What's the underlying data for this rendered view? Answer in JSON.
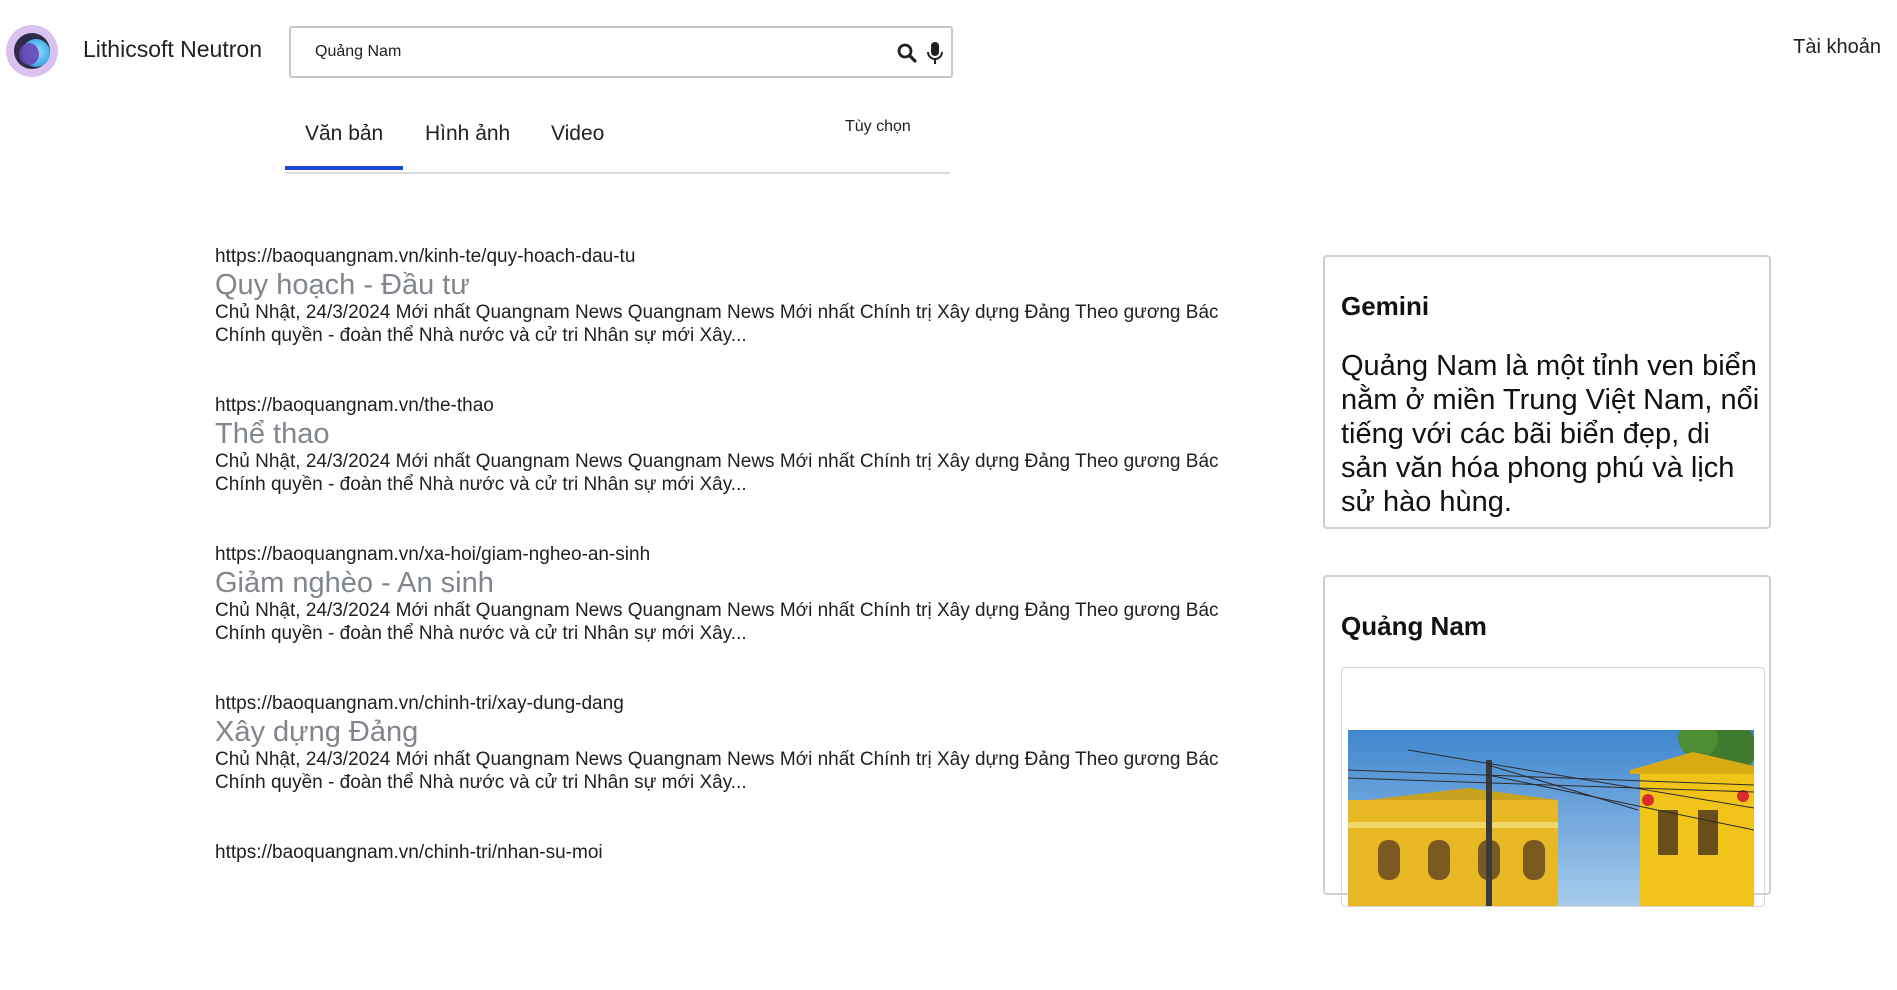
{
  "app": {
    "brand_name": "Lithicsoft Neutron",
    "logo_icon": "neutron-logo-icon",
    "account_label": "Tài khoản"
  },
  "search": {
    "query": "Quảng Nam",
    "search_icon": "search-icon",
    "mic_icon": "microphone-icon"
  },
  "tabs": {
    "items": [
      {
        "label": "Văn bản",
        "active": true
      },
      {
        "label": "Hình ảnh",
        "active": false
      },
      {
        "label": "Video",
        "active": false
      }
    ],
    "options_label": "Tùy chọn"
  },
  "results": [
    {
      "url": "https://baoquangnam.vn/kinh-te/quy-hoach-dau-tu",
      "title": "Quy hoạch - Đầu tư",
      "snippet": "Chủ Nhật, 24/3/2024 Mới nhất Quangnam News Quangnam News Mới nhất Chính trị Xây dựng Đảng Theo gương Bác Chính quyền - đoàn thể Nhà nước và cử tri Nhân sự mới Xây..."
    },
    {
      "url": "https://baoquangnam.vn/the-thao",
      "title": "Thể thao",
      "snippet": "Chủ Nhật, 24/3/2024 Mới nhất Quangnam News Quangnam News Mới nhất Chính trị Xây dựng Đảng Theo gương Bác Chính quyền - đoàn thể Nhà nước và cử tri Nhân sự mới Xây..."
    },
    {
      "url": "https://baoquangnam.vn/xa-hoi/giam-ngheo-an-sinh",
      "title": "Giảm nghèo - An sinh",
      "snippet": "Chủ Nhật, 24/3/2024 Mới nhất Quangnam News Quangnam News Mới nhất Chính trị Xây dựng Đảng Theo gương Bác Chính quyền - đoàn thể Nhà nước và cử tri Nhân sự mới Xây..."
    },
    {
      "url": "https://baoquangnam.vn/chinh-tri/xay-dung-dang",
      "title": "Xây dựng Đảng",
      "snippet": "Chủ Nhật, 24/3/2024 Mới nhất Quangnam News Quangnam News Mới nhất Chính trị Xây dựng Đảng Theo gương Bác Chính quyền - đoàn thể Nhà nước và cử tri Nhân sự mới Xây..."
    },
    {
      "url": "https://baoquangnam.vn/chinh-tri/nhan-su-moi",
      "title": "",
      "snippet": ""
    }
  ],
  "gemini": {
    "title": "Gemini",
    "text": "Quảng Nam là một tỉnh ven biển nằm ở miền Trung Việt Nam, nổi tiếng với các bãi biển đẹp, di sản văn hóa phong phú và lịch sử hào hùng."
  },
  "knowledge_panel": {
    "title": "Quảng Nam",
    "image_description_icon": "hoi-an-street-photo"
  },
  "colors": {
    "tab_underline": "#1a47d8",
    "result_title": "#80868b",
    "logo_outer": "#d9c2f0"
  }
}
